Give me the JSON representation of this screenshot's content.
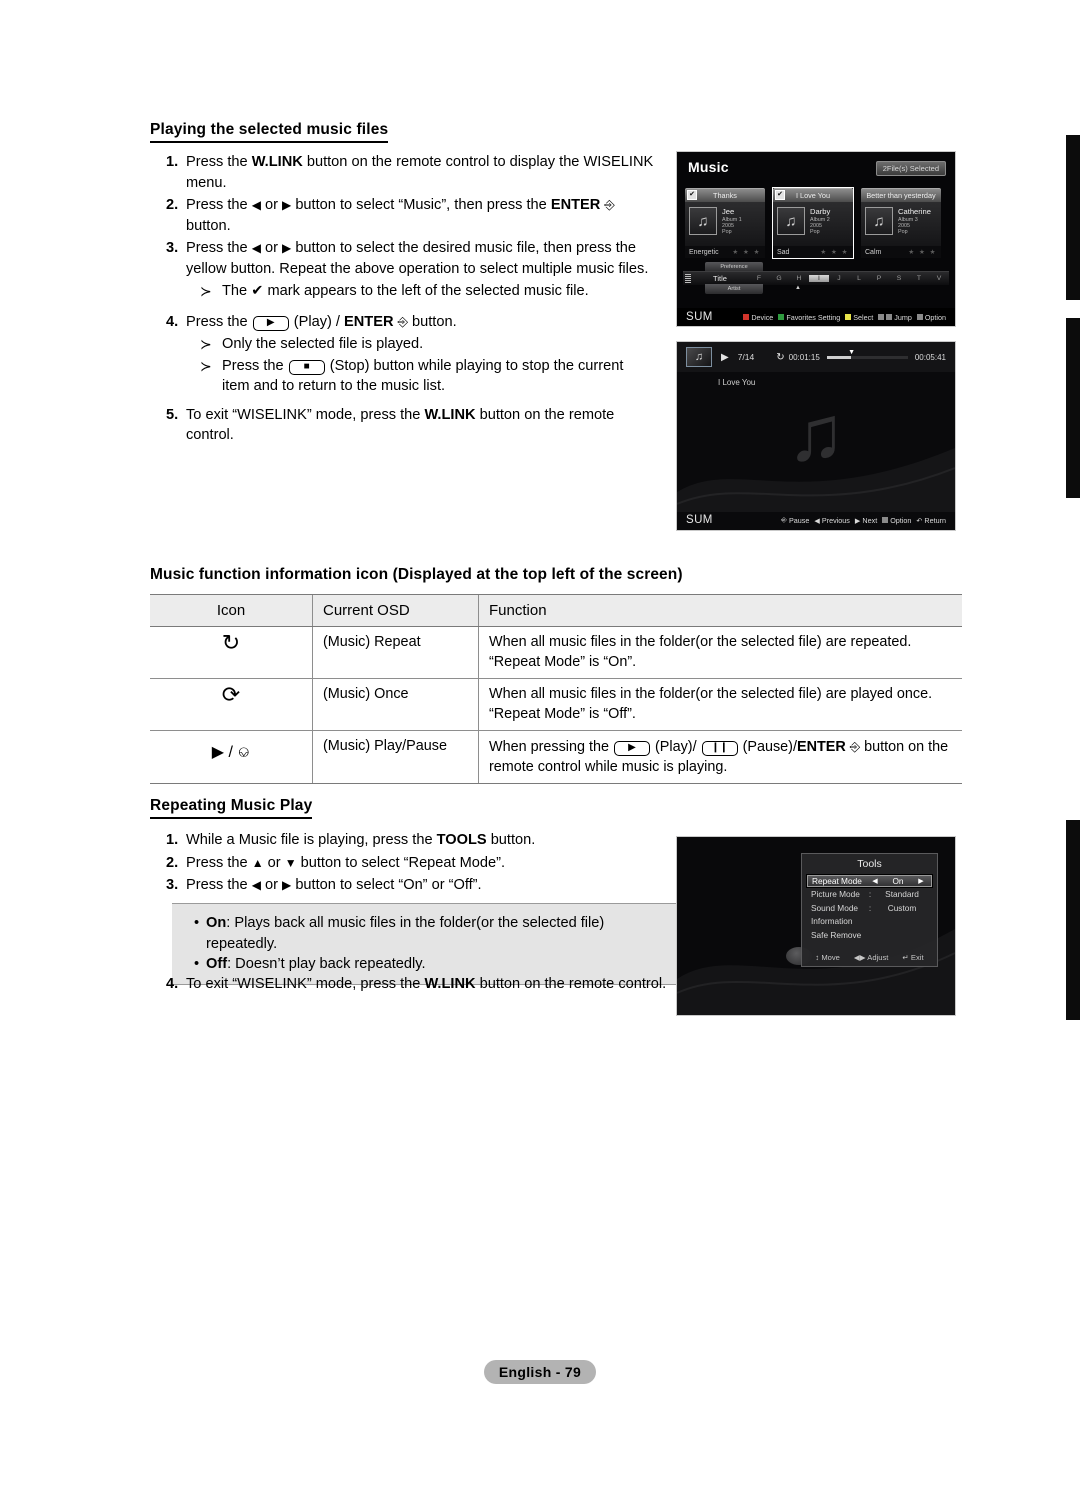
{
  "section1": {
    "heading": "Playing the selected music files",
    "steps": [
      {
        "num": "1.",
        "text_a": "Press the ",
        "bold_a": "W.LINK",
        "text_b": " button on the remote control to display the WISELINK menu."
      },
      {
        "num": "2.",
        "text_a": "Press the ",
        "text_mid": " or ",
        "text_b": " button to select “Music”, then press the ",
        "bold_b": "ENTER",
        "text_c": " button."
      },
      {
        "num": "3.",
        "text_a": "Press the ",
        "text_mid": " or ",
        "text_b": " button to select the desired music file, then press the yellow button. Repeat the above operation to select multiple music files."
      },
      {
        "num": "4.",
        "text_a": "Press the ",
        "text_b": " (Play) / ",
        "bold_b": "ENTER",
        "text_c": " button."
      },
      {
        "num": "5.",
        "text_a": "To exit “WISELINK” mode, press the ",
        "bold_a": "W.LINK",
        "text_b": " button on the remote control."
      }
    ],
    "bullets": {
      "b3": "The ✔ mark appears to the left of the selected music file.",
      "b4a": "Only the selected file is played.",
      "b4b_pre": "Press the ",
      "b4b_post": " (Stop) button while playing to stop the current item and to return to the music list."
    }
  },
  "section2": {
    "heading": "Music function information icon (Displayed at the top left of the screen)",
    "table": {
      "headers": [
        "Icon",
        "Current OSD",
        "Function"
      ],
      "rows": [
        {
          "icon": "repeat-loop-icon",
          "icon_glyph": "↻",
          "osd": "(Music) Repeat",
          "func_line1": "When all music files in the folder(or the selected file) are repeated.",
          "func_line2": "“Repeat Mode” is “On”."
        },
        {
          "icon": "once-arrow-icon",
          "icon_glyph": "⟳",
          "osd": "(Music) Once",
          "func_line1": "When all music files in the folder(or the selected file) are played once.",
          "func_line2": "“Repeat Mode” is “Off”."
        },
        {
          "icon": "play-pause-icon",
          "icon_glyph": "▶ / ⎉",
          "osd": "(Music) Play/Pause",
          "func_pre": "When pressing the ",
          "func_mid1": " (Play)/ ",
          "func_mid2": " (Pause)/",
          "func_bold": "ENTER",
          "func_post": " button on the remote control while music is playing."
        }
      ]
    }
  },
  "section3": {
    "heading": "Repeating Music Play",
    "steps": [
      {
        "num": "1.",
        "text_a": "While a Music file is playing, press the ",
        "bold_a": "TOOLS",
        "text_b": " button."
      },
      {
        "num": "2.",
        "text_a": "Press the ",
        "text_mid": " or ",
        "text_b": " button to select “Repeat Mode”."
      },
      {
        "num": "3.",
        "text_a": "Press the ",
        "text_mid": " or ",
        "text_b": " button to select “On” or “Off”."
      },
      {
        "num": "4.",
        "text_a": "To exit “WISELINK” mode, press the ",
        "bold_a": "W.LINK",
        "text_b": " button on the remote control."
      }
    ],
    "note": {
      "on_label": "On",
      "on_text": ": Plays back all music files in the folder(or the selected file) repeatedly.",
      "off_label": "Off",
      "off_text": ": Doesn’t play back repeatedly."
    }
  },
  "music_list": {
    "title": "Music",
    "badge": "2File(s) Selected",
    "cards": [
      {
        "title": "Thanks",
        "artist": "Jee",
        "album": "Album 1",
        "year": "2005",
        "genre": "Pop",
        "mood": "Energetic",
        "stars": "★ ★ ★",
        "checked": "✔",
        "selected": false
      },
      {
        "title": "I Love You",
        "artist": "Darby",
        "album": "Album 2",
        "year": "2005",
        "genre": "Pop",
        "mood": "Sad",
        "stars": "★ ★ ★",
        "checked": "✔",
        "selected": true
      },
      {
        "title": "Better than yesterday",
        "artist": "Catherine",
        "album": "Album 3",
        "year": "2005",
        "genre": "Pop",
        "mood": "Calm",
        "stars": "★ ★ ★",
        "checked": "",
        "selected": false
      }
    ],
    "tab_top": "Preference",
    "tab_bottom": "Artist",
    "sort_label": "Title",
    "letters": [
      "F",
      "G",
      "H",
      "I",
      "J",
      "L",
      "P",
      "S",
      "T",
      "V"
    ],
    "active_letter": "I",
    "device_label": "SUM",
    "hints": [
      {
        "label": "Device",
        "color": "#d2352c"
      },
      {
        "label": "Favorites Setting",
        "color": "#2f9b3f"
      },
      {
        "label": "Select",
        "color": "#e8e44a"
      },
      {
        "label": "Jump",
        "color": "#8a8a8a"
      },
      {
        "label": "Option",
        "color": "#8a8a8a"
      }
    ]
  },
  "player": {
    "index": "7/14",
    "elapsed": "00:01:15",
    "total": "00:05:41",
    "song": "I Love You",
    "device_label": "SUM",
    "progress_percent": 30,
    "hints": [
      {
        "label": "Pause",
        "icon": "enter-icon"
      },
      {
        "label": "Previous",
        "icon": "left-arrow-icon"
      },
      {
        "label": "Next",
        "icon": "right-arrow-icon"
      },
      {
        "label": "Option",
        "icon": "tools-icon"
      },
      {
        "label": "Return",
        "icon": "return-icon"
      }
    ]
  },
  "tools": {
    "title": "Tools",
    "rows": [
      {
        "label": "Repeat Mode",
        "value": "On",
        "highlighted": true,
        "arrows": true
      },
      {
        "label": "Picture Mode",
        "value": "Standard",
        "highlighted": false,
        "arrows": false
      },
      {
        "label": "Sound Mode",
        "value": "Custom",
        "highlighted": false,
        "arrows": false
      },
      {
        "label": "Information",
        "value": "",
        "highlighted": false,
        "arrows": false
      },
      {
        "label": "Safe Remove",
        "value": "",
        "highlighted": false,
        "arrows": false
      }
    ],
    "footer": [
      {
        "icon": "↕",
        "label": "Move"
      },
      {
        "icon": "◀▶",
        "label": "Adjust"
      },
      {
        "icon": "↵",
        "label": "Exit"
      }
    ]
  },
  "footer": {
    "page_label": "English - 79"
  }
}
